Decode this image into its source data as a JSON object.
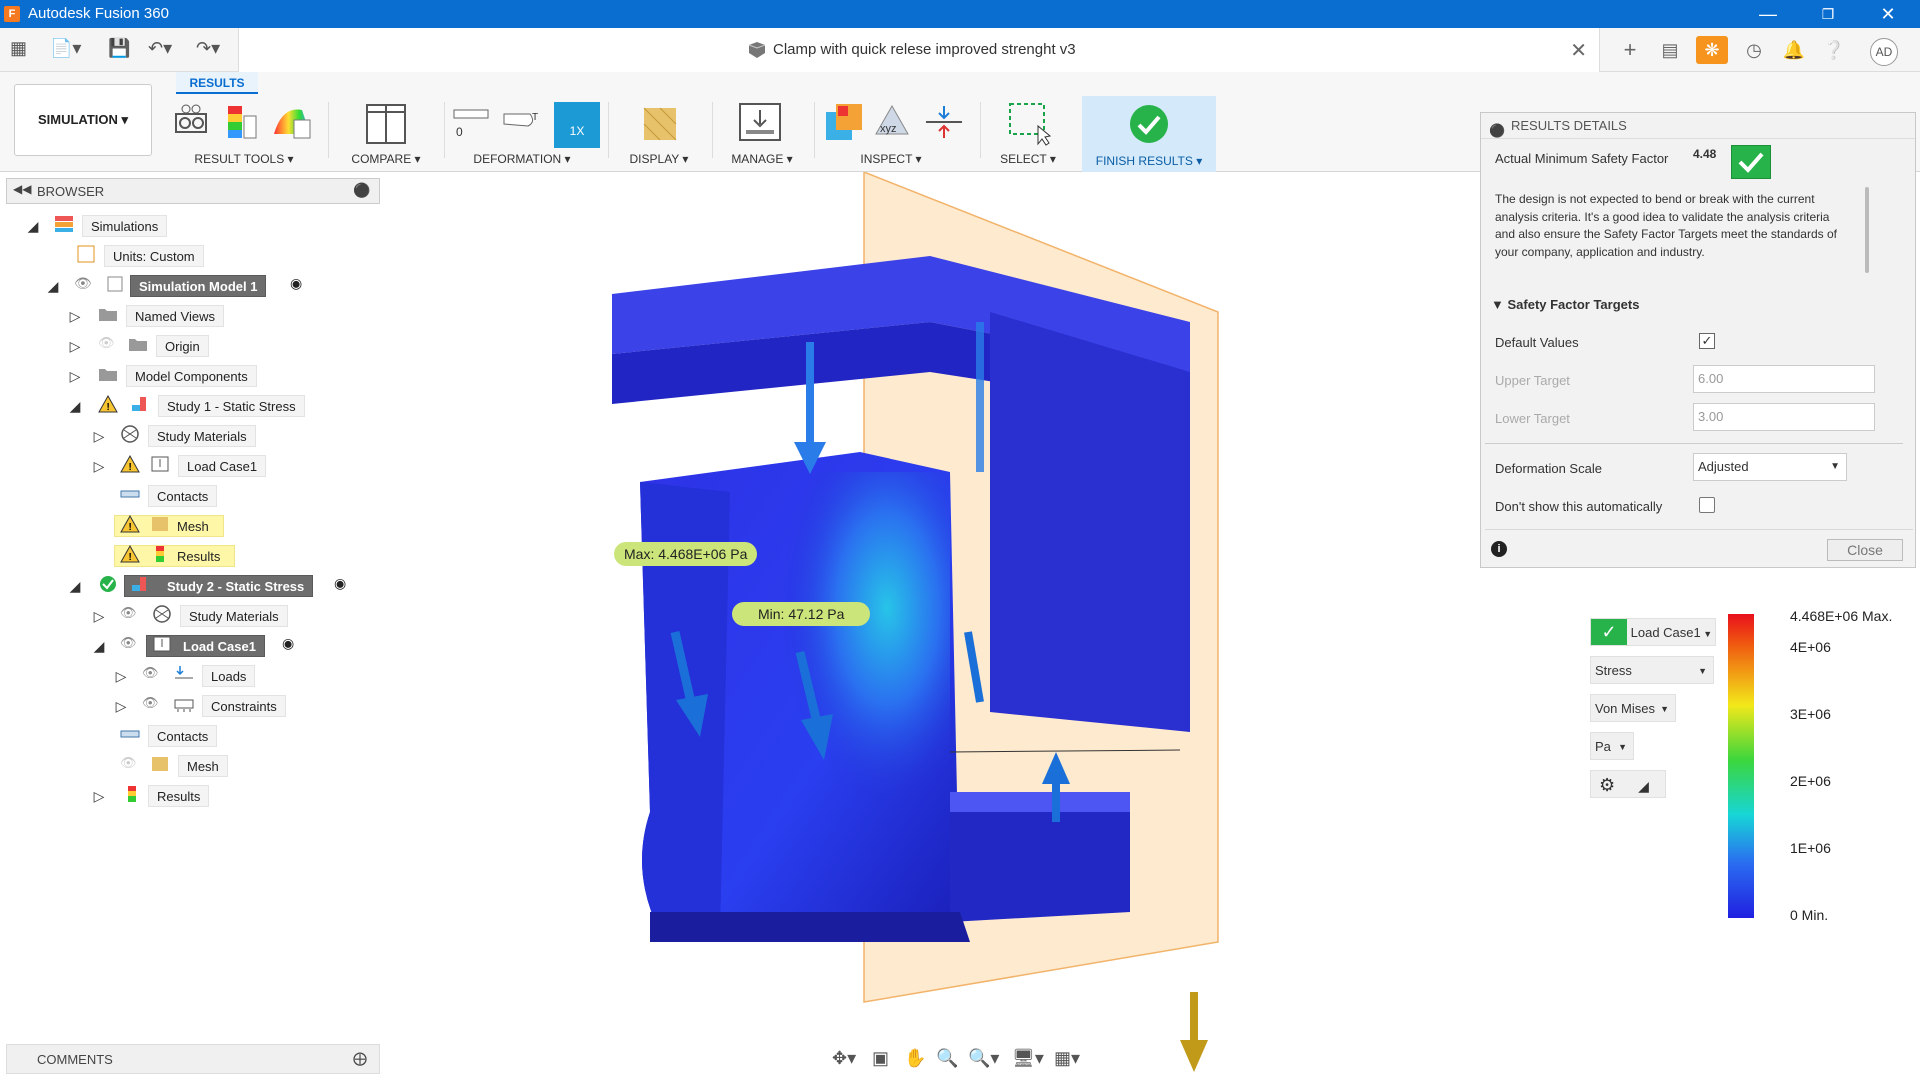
{
  "window": {
    "title": "Autodesk Fusion 360",
    "logo_letter": "F"
  },
  "document": {
    "name": "Clamp with quick relese improved strenght v3"
  },
  "user": {
    "initials": "AD"
  },
  "ribbon": {
    "workspace": "SIMULATION ▾",
    "active_tab": "RESULTS",
    "groups": [
      {
        "label": "RESULT TOOLS ▾"
      },
      {
        "label": "COMPARE ▾"
      },
      {
        "label": "DEFORMATION ▾"
      },
      {
        "label": "DISPLAY ▾"
      },
      {
        "label": "MANAGE ▾"
      },
      {
        "label": "INSPECT ▾"
      },
      {
        "label": "SELECT ▾"
      },
      {
        "label": "FINISH RESULTS ▾"
      }
    ],
    "deformation_zero": "0",
    "deformation_scale_btn": "1X"
  },
  "browser": {
    "title": "BROWSER",
    "items": [
      {
        "label": "Simulations"
      },
      {
        "label": "Units: Custom"
      },
      {
        "label": "Simulation Model 1"
      },
      {
        "label": "Named Views"
      },
      {
        "label": "Origin"
      },
      {
        "label": "Model Components"
      },
      {
        "label": "Study 1 - Static Stress"
      },
      {
        "label": "Study Materials"
      },
      {
        "label": "Load Case1"
      },
      {
        "label": "Contacts"
      },
      {
        "label": "Mesh"
      },
      {
        "label": "Results"
      },
      {
        "label": "Study 2 - Static Stress"
      },
      {
        "label": "Study Materials"
      },
      {
        "label": "Load Case1"
      },
      {
        "label": "Loads"
      },
      {
        "label": "Constraints"
      },
      {
        "label": "Contacts"
      },
      {
        "label": "Mesh"
      },
      {
        "label": "Results"
      }
    ]
  },
  "comments": {
    "title": "COMMENTS"
  },
  "viewport": {
    "max_label": "Max: 4.468E+06 Pa",
    "min_label": "Min: 47.12 Pa"
  },
  "results_details": {
    "title": "RESULTS DETAILS",
    "safety_factor_label": "Actual Minimum Safety Factor",
    "safety_factor_value": "4.48",
    "message": "The design is not expected to bend or break with the current analysis criteria. It's a good idea to validate the analysis criteria and also ensure the Safety Factor Targets meet the standards of your company, application and industry.",
    "targets_header": "Safety Factor Targets",
    "default_values_label": "Default Values",
    "upper_target_label": "Upper Target",
    "upper_target_value": "6.00",
    "lower_target_label": "Lower Target",
    "lower_target_value": "3.00",
    "deformation_scale_label": "Deformation Scale",
    "deformation_scale_value": "Adjusted",
    "dont_show_label": "Don't show this automatically",
    "close_label": "Close"
  },
  "legend": {
    "load_case": "Load Case1",
    "result_type": "Stress",
    "component": "Von Mises",
    "unit": "Pa",
    "ticks": [
      "4.468E+06 Max.",
      "4E+06",
      "3E+06",
      "2E+06",
      "1E+06",
      "0 Min."
    ]
  }
}
